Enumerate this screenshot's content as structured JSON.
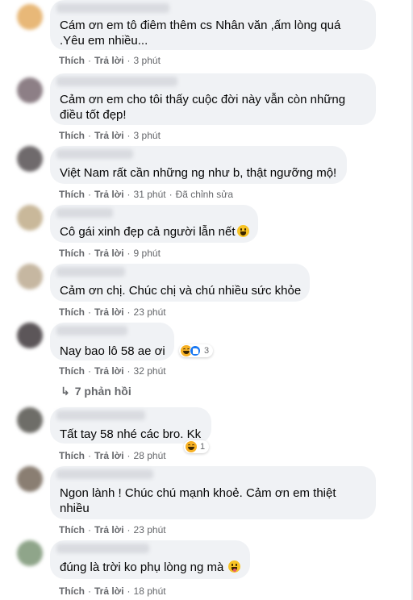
{
  "actions": {
    "like": "Thích",
    "reply": "Trả lời"
  },
  "comments": [
    {
      "text": "Cám ơn em tô điêm thêm cs Nhân văn ,ấm lòng quá\n.Yêu em nhiều...",
      "time": "3 phút",
      "edited": "",
      "avatar_color": "#e8b878"
    },
    {
      "text": "Cảm ơn em cho tôi thấy cuộc đời này vẫn còn những\nđiều tốt đẹp!",
      "time": "3 phút",
      "edited": "",
      "avatar_color": "#8d7f86"
    },
    {
      "text": "Việt Nam rất cần những ng như b, thật ngưỡng mộ!",
      "time": "31 phút",
      "edited": "Đã chỉnh sửa",
      "avatar_color": "#6f6a6c"
    },
    {
      "text": "Cô gái xinh đẹp cả người lẫn nết",
      "time": "9 phút",
      "edited": "",
      "avatar_color": "#c9b89a"
    },
    {
      "text": "Cảm ơn chị. Chúc chị và chú nhiều sức khỏe",
      "time": "23 phút",
      "edited": "",
      "avatar_color": "#c6b7a1"
    },
    {
      "text": "Nay bao lô 58 ae ơi",
      "time": "32 phút",
      "edited": "",
      "avatar_color": "#5c5659",
      "reaction_count": "3"
    },
    {
      "text": "Tất tay 58 nhé các bro. Kk",
      "time": "28 phút",
      "edited": "",
      "avatar_color": "#6e6d68",
      "reaction_count": "1"
    },
    {
      "text": "Ngon lành ! Chúc chú mạnh khoẻ. Cảm ơn em thiệt\nnhiều",
      "time": "23 phút",
      "edited": "",
      "avatar_color": "#8a7e72"
    },
    {
      "text": "đúng là trời ko phụ lòng ng mà",
      "time": "18 phút",
      "edited": "",
      "avatar_color": "#8fa58a"
    }
  ],
  "replies_link": "7 phản hồi",
  "colors": {
    "bubble": "#f0f2f5",
    "secondary_text": "#65676b",
    "like_blue": "#1877f2",
    "haha_yellow": "#f7b125"
  },
  "icons": [
    "haha-reaction-icon",
    "like-reaction-icon",
    "reply-arrow-icon",
    "grinning-emoji-icon",
    "tongue-emoji-icon"
  ]
}
